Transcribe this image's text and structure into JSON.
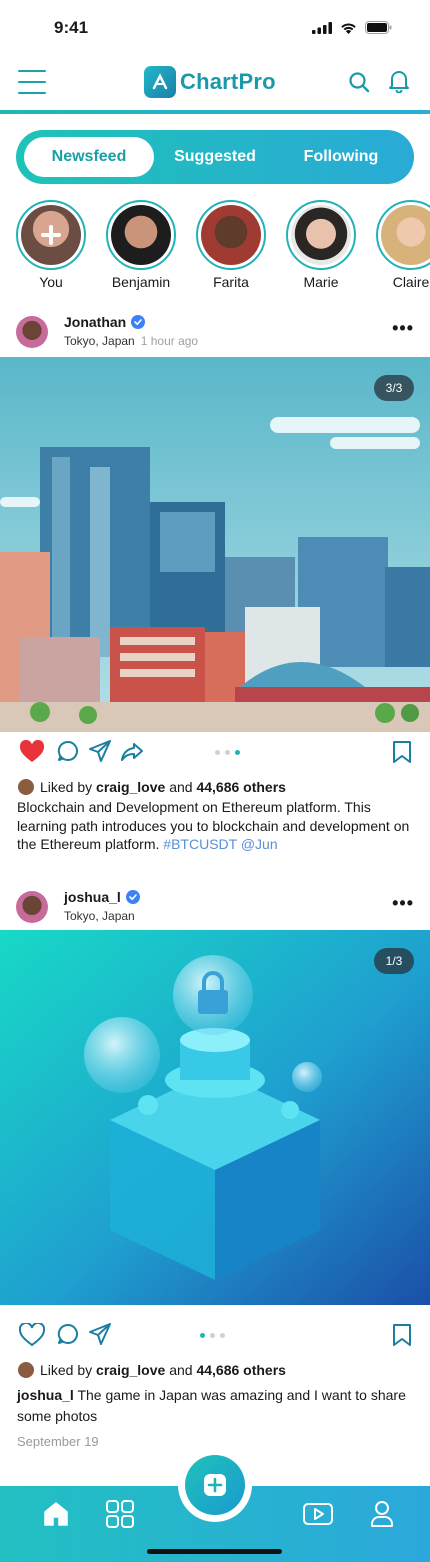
{
  "status": {
    "time": "9:41"
  },
  "app": {
    "name": "ChartPro"
  },
  "tabs": [
    {
      "label": "Newsfeed",
      "active": true
    },
    {
      "label": "Suggested",
      "active": false
    },
    {
      "label": "Following",
      "active": false
    }
  ],
  "stories": [
    {
      "name": "You",
      "icon": "plus-icon"
    },
    {
      "name": "Benjamin"
    },
    {
      "name": "Farita"
    },
    {
      "name": "Marie"
    },
    {
      "name": "Claire"
    }
  ],
  "posts": [
    {
      "author": "Jonathan",
      "verified": true,
      "location": "Tokyo, Japan",
      "time_ago": "1 hour ago",
      "image_counter": "3/3",
      "liked_prefix": "Liked by",
      "liked_user": "craig_love",
      "liked_and": "and",
      "liked_others": "44,686 others",
      "caption": "Blockchain and Development on Ethereum platform. This learning path introduces you to blockchain and development on the Ethereum platform.",
      "hashtag": "#BTCUSDT",
      "mention": "@Jun",
      "liked": true
    },
    {
      "author": "joshua_l",
      "verified": true,
      "location": "Tokyo, Japan",
      "image_counter": "1/3",
      "liked_prefix": "Liked by",
      "liked_user": "craig_love",
      "liked_and": "and",
      "liked_others": "44,686 others",
      "caption_author": "joshua_l",
      "caption": "The game in Japan was amazing and I want to share some photos",
      "date": "September 19",
      "liked": false
    }
  ],
  "colors": {
    "accent": "#1fb3b6",
    "accent2": "#2aaad6",
    "like": "#e8333a",
    "hashtag": "#5b8fd8"
  },
  "nav": [
    "home-icon",
    "grid-icon",
    "add-icon",
    "video-icon",
    "profile-icon"
  ]
}
